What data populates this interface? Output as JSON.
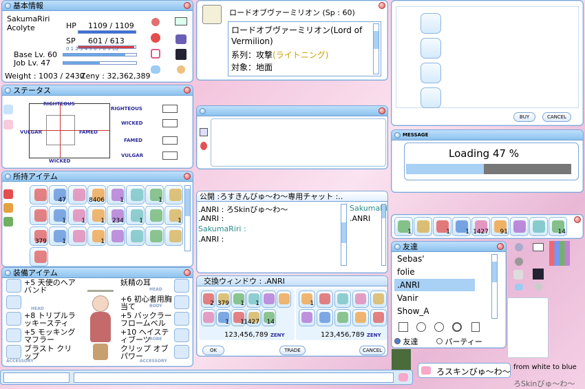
{
  "basic": {
    "title": "基本情報",
    "name": "SakumaRiri",
    "job": "Acolyte",
    "hp_label": "HP",
    "hp": "1109 / 1109",
    "sp_label": "SP",
    "sp": "601 / 613",
    "base_label": "Base Lv. 60",
    "job_lv_label": "Job Lv. 47",
    "weight": "Weight : 1003 / 2430",
    "zeny": "Zeny : 32,362,389",
    "exp_scale": "0 1 2 3 4 5 6 7 8 9 10",
    "hp_fill": 1.0,
    "sp_fill": 0.98,
    "base_fill": 0.85,
    "job_fill": 0.5
  },
  "skill": {
    "name": "ロードオブヴァーミリオン (Sp : 60)",
    "desc_line1": "ロードオブヴァーミリオン(Lord of",
    "desc_line2": "Vermilion)",
    "attr_label": "系列：攻撃",
    "attr_value": "(ライトニング)",
    "target": "対象：地面"
  },
  "status": {
    "title": "ステータス",
    "top": "RIGHTEOUS",
    "bottom": "WICKED",
    "left": "VULGAR",
    "right": "FAMED",
    "rows": [
      "RIGHTEOUS",
      "WICKED",
      "FAMED",
      "VULGAR"
    ]
  },
  "items": {
    "title": "所持アイテム",
    "counts": [
      "",
      "47",
      "",
      "8406",
      "1",
      "",
      "1",
      "",
      "",
      "1",
      "1",
      "1",
      "234",
      "1",
      "",
      "1",
      "379",
      "1",
      "",
      "1",
      "",
      "",
      "",
      "",
      ""
    ]
  },
  "equip": {
    "title": "装備アイテム",
    "left": [
      "+5 天使のヘアバンド",
      "",
      "+8 トリプルラッキースティ",
      "+5 モッキングマフラー",
      "ブラスト クリップ"
    ],
    "right": [
      "妖精の耳",
      "+6 初心者用胸当て",
      "+5 バックラー フロームベル",
      "+10 ヘイスティブーツ",
      "クリップ オブ パワー"
    ],
    "slot_labels": {
      "head": "HEAD",
      "acc_left": "ACCESSORY",
      "head_r": "HEAD",
      "body": "BODY",
      "robe": "ROBE",
      "acc_right": "ACCESSORY"
    }
  },
  "chat": {
    "title": "公開 :ろすきんびゅ〜わ〜専用チャット :..",
    "lines": [
      ".ANRI : ろSkinびゅ〜わ〜",
      ".ANRI :",
      "SakumaRiri :",
      ".ANRI :"
    ],
    "members": [
      "SakumaRiri",
      ".ANRI"
    ]
  },
  "trade": {
    "title": "交換ウィンドウ : .ANRI",
    "left_counts": [
      "2",
      "379",
      "1",
      "1",
      "",
      "",
      "",
      "1",
      "1",
      "1427",
      "14"
    ],
    "right_counts": [
      "1",
      "",
      "",
      "",
      ""
    ],
    "left_zeny": "123,456,789",
    "right_zeny": "123,456,789",
    "zeny_label": "ZENY",
    "ok": "OK",
    "trade": "TRADE",
    "cancel": "CANCEL"
  },
  "shop": {
    "buy": "BUY",
    "cancel": "CANCEL"
  },
  "message": {
    "title": "MESSAGE",
    "text": "Loading 47 %",
    "progress": 0.47
  },
  "hotbar": {
    "counts": [
      "1",
      "",
      "1",
      "1",
      "1427",
      "91",
      "",
      "",
      "14"
    ]
  },
  "friends": {
    "title": "友達",
    "list": [
      "Sebas'",
      "folie",
      ".ANRI",
      "Vanir",
      "Show_A"
    ],
    "tab1": "友達",
    "tab2": "パーティー"
  },
  "bottom": {
    "chat_input": "ろスキンびゅ〜わ〜",
    "right_text": "from white to blue",
    "signature": "ろSkinびゅ〜わ〜"
  },
  "colors": {
    "accent": "#8cc2ee",
    "hp": "#3b6fd6",
    "sp": "#d94040",
    "selected": "#a9d0f5"
  }
}
